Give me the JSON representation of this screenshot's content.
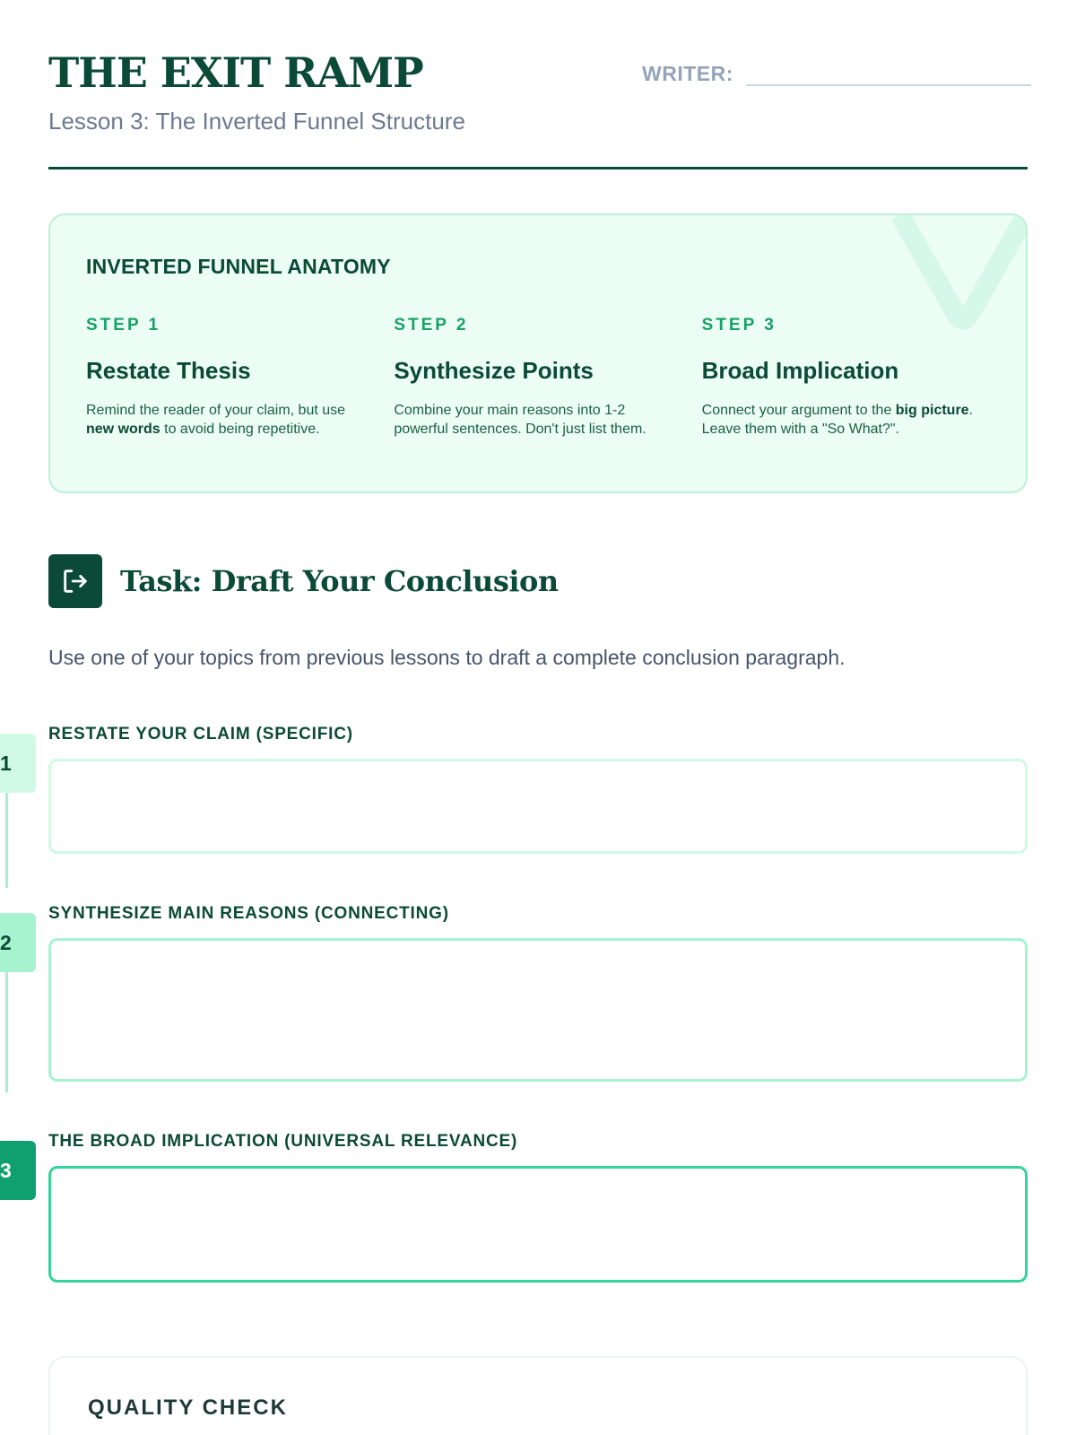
{
  "header": {
    "title": "THE EXIT RAMP",
    "subtitle": "Lesson 3: The Inverted Funnel Structure",
    "writer_label": "WRITER:",
    "writer_value": ""
  },
  "anatomy": {
    "title": "INVERTED FUNNEL ANATOMY",
    "steps": [
      {
        "number": "STEP 1",
        "name": "Restate Thesis",
        "desc_parts": [
          "Remind the reader of your claim, but use ",
          "new words",
          " to avoid being repetitive."
        ]
      },
      {
        "number": "STEP 2",
        "name": "Synthesize Points",
        "desc_parts": [
          "Combine your main reasons into 1-2 powerful sentences. Don't just list them."
        ]
      },
      {
        "number": "STEP 3",
        "name": "Broad Implication",
        "desc_parts": [
          "Connect your argument to the ",
          "big picture",
          ". Leave them with a \"So What?\"."
        ]
      }
    ]
  },
  "task": {
    "icon": "exit-arrow-icon",
    "title": "Task: Draft Your Conclusion",
    "description": "Use one of your topics from previous lessons to draft a complete conclusion paragraph."
  },
  "fields": [
    {
      "number": "1",
      "label": "RESTATE YOUR CLAIM (SPECIFIC)",
      "value": ""
    },
    {
      "number": "2",
      "label": "SYNTHESIZE MAIN REASONS (CONNECTING)",
      "value": ""
    },
    {
      "number": "3",
      "label": "THE BROAD IMPLICATION (UNIVERSAL RELEVANCE)",
      "value": ""
    }
  ],
  "quality": {
    "title": "QUALITY CHECK"
  },
  "colors": {
    "brand_dark": "#0b4a36",
    "accent_green": "#16a06a",
    "card_bg": "#ecfdf5",
    "badge_1_bg": "#d1fae5",
    "badge_2_bg": "#a7f3d0",
    "badge_3_bg": "#10a070",
    "field_1_border": "#d1fae5",
    "field_2_border": "#a7f3d0",
    "field_3_border": "#34d399"
  }
}
